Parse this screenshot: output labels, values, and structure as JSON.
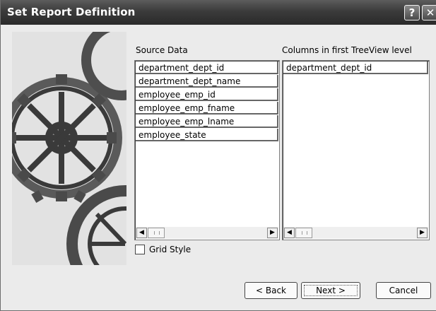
{
  "window": {
    "title": "Set Report Definition",
    "help_label": "?",
    "close_label": "✕"
  },
  "source": {
    "label": "Source Data",
    "items": [
      "department_dept_id",
      "department_dept_name",
      "employee_emp_id",
      "employee_emp_fname",
      "employee_emp_lname",
      "employee_state"
    ]
  },
  "columns": {
    "label": "Columns in first TreeView level",
    "items": [
      "department_dept_id"
    ]
  },
  "grid_style": {
    "label": "Grid Style",
    "checked": false
  },
  "buttons": {
    "back": "< Back",
    "next": "Next >",
    "cancel": "Cancel"
  },
  "icons": {
    "scroll_left": "◀",
    "scroll_right": "▶",
    "art": "gears-illustration"
  }
}
